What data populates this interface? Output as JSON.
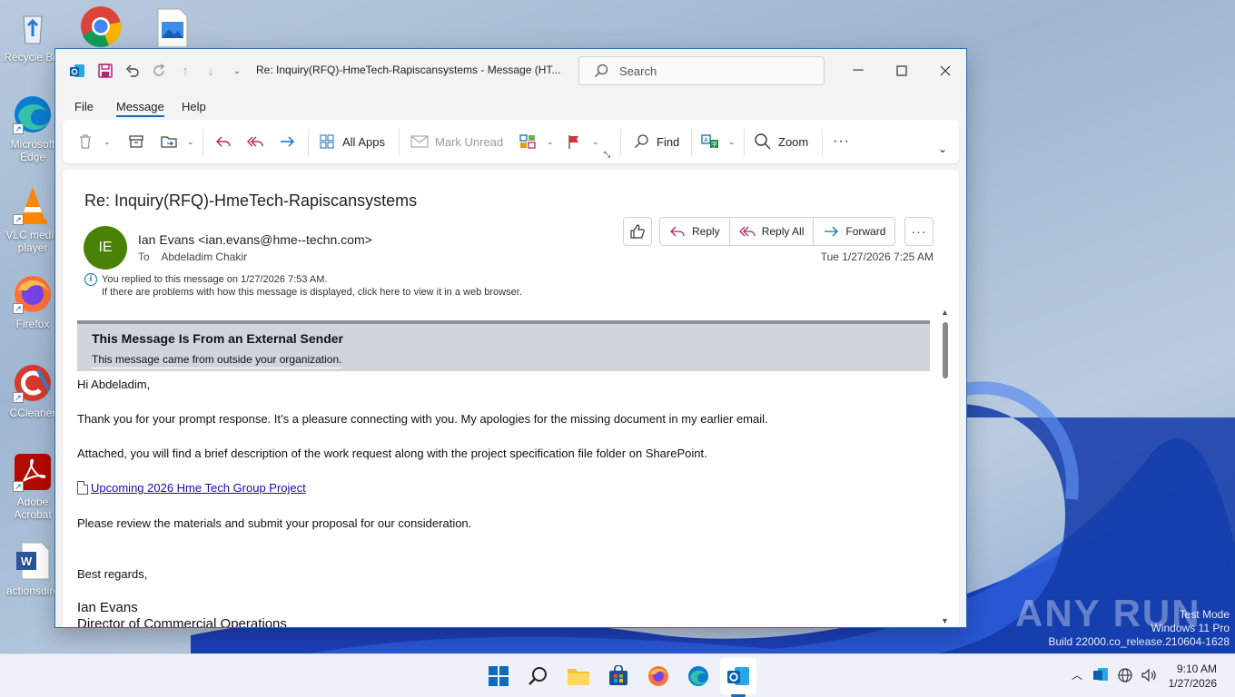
{
  "desktop": {
    "icons": [
      {
        "label": "Recycle Bin",
        "icon": "recycle-bin-icon"
      },
      {
        "label": "Microsoft Edge",
        "icon": "edge-icon"
      },
      {
        "label": "VLC media player",
        "icon": "vlc-icon"
      },
      {
        "label": "Firefox",
        "icon": "firefox-icon"
      },
      {
        "label": "CCleaner",
        "icon": "ccleaner-icon"
      },
      {
        "label": "Adobe Acrobat",
        "icon": "acrobat-icon"
      },
      {
        "label": "actionsdire",
        "icon": "word-doc-icon"
      }
    ],
    "top_icons": [
      "chrome-icon",
      "image-file-icon"
    ]
  },
  "window": {
    "title": "Re: Inquiry(RFQ)-HmeTech-Rapiscansystems  -  Message (HT...",
    "search_placeholder": "Search",
    "menu": [
      "File",
      "Message",
      "Help"
    ],
    "active_menu": "Message"
  },
  "ribbon": {
    "all_apps": "All Apps",
    "mark_unread": "Mark Unread",
    "find": "Find",
    "zoom": "Zoom",
    "more": "···"
  },
  "message": {
    "subject": "Re: Inquiry(RFQ)-HmeTech-Rapiscansystems",
    "avatar_initials": "IE",
    "from": "Ian Evans <ian.evans@hme--techn.com>",
    "to_label": "To",
    "to": "Abdeladim Chakir",
    "date": "Tue 1/27/2026 7:25 AM",
    "reply": "Reply",
    "reply_all": "Reply All",
    "forward": "Forward",
    "info_replied": "You replied to this message on 1/27/2026 7:53 AM.",
    "info_browser": "If there are problems with how this message is displayed, click here to view it in a web browser.",
    "external_title": "This Message Is From an External Sender",
    "external_sub": "This message came from outside your organization.",
    "greeting": "Hi Abdeladim,",
    "para1": "Thank you for your prompt response. It’s a pleasure connecting with you. My apologies for the missing document in my earlier email.",
    "para2": "Attached, you will find a brief description of the work request along with the project specification file folder on SharePoint.",
    "link": "Upcoming 2026 Hme Tech Group Project ",
    "para3": "Please review the materials and submit your proposal for our consideration.",
    "closing": "Best regards,",
    "sig_name": "Ian Evans",
    "sig_title": "Director of Commercial Operations"
  },
  "taskbar": {
    "time": "9:10 AM",
    "date": "1/27/2026"
  },
  "watermark": {
    "line1": "Test Mode",
    "line2": "Windows 11 Pro",
    "line3": "Build 22000.co_release.210604-1628",
    "brand": "ANY RUN"
  },
  "colors": {
    "accent": "#0f6cbd",
    "avatar": "#498205",
    "banner": "#d0d5dc"
  }
}
